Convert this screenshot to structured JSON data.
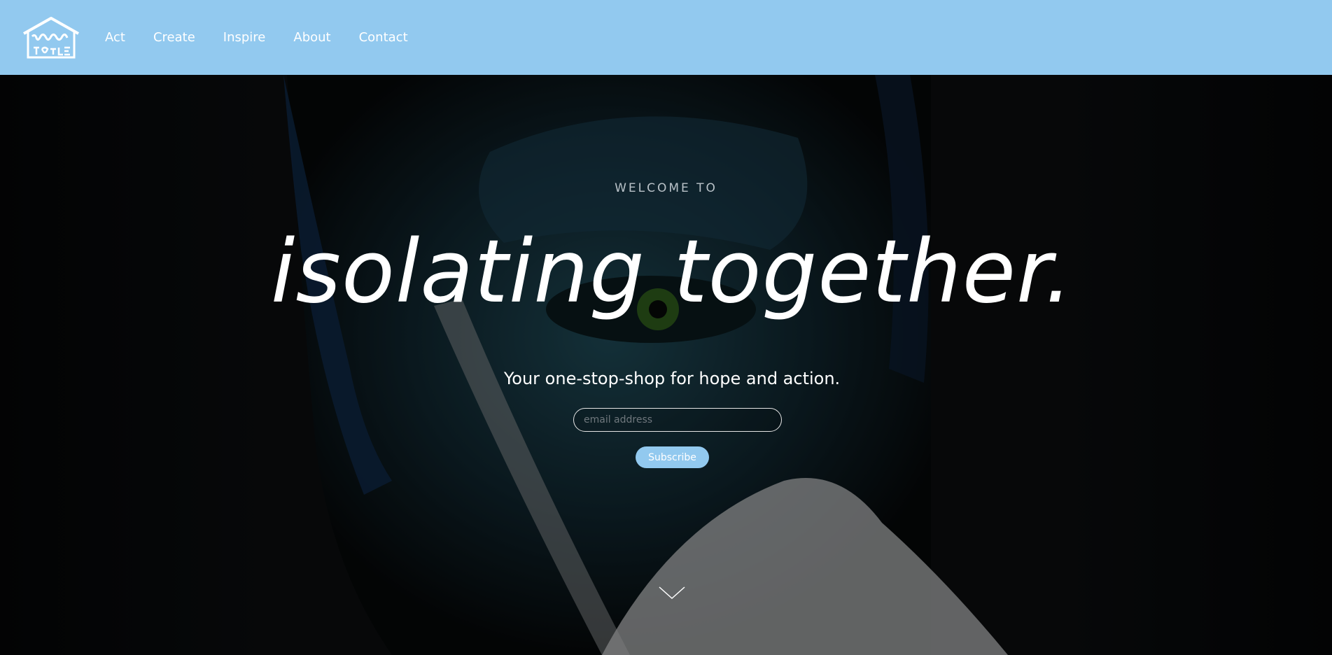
{
  "brand": {
    "logo_text": "isolating together"
  },
  "nav": {
    "items": [
      {
        "label": "Act"
      },
      {
        "label": "Create"
      },
      {
        "label": "Inspire"
      },
      {
        "label": "About"
      },
      {
        "label": "Contact"
      }
    ]
  },
  "hero": {
    "welcome": "WELCOME TO",
    "headline": "isolating together.",
    "tagline": "Your one-stop-shop for hope and action.",
    "email_placeholder": "email address",
    "subscribe_label": "Subscribe",
    "scroll_icon": "chevron-down-icon"
  },
  "colors": {
    "header_bg": "#92c9ef",
    "accent": "#92c9ef",
    "hero_bg": "#07090b",
    "text": "#ffffff"
  }
}
